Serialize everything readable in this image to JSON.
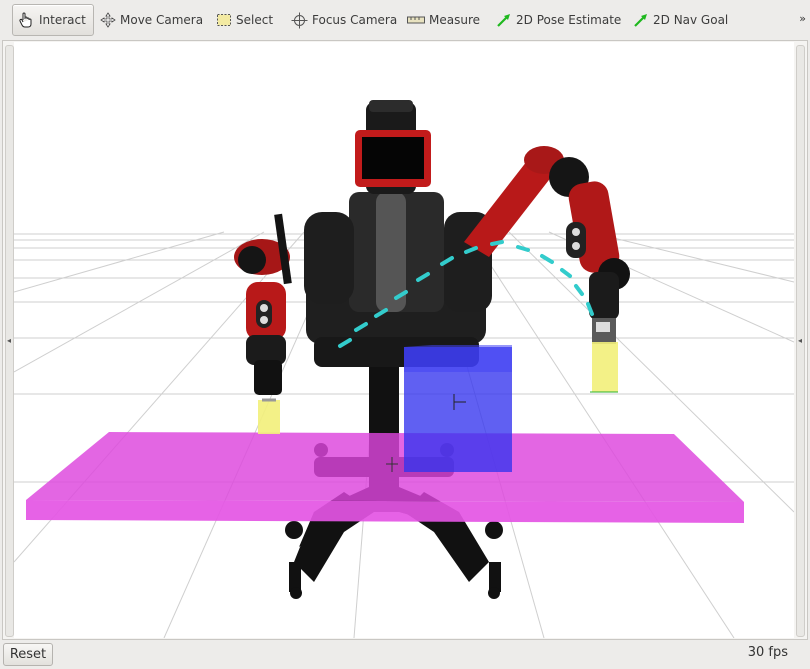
{
  "toolbar": {
    "tools": [
      {
        "label": "Interact",
        "icon": "hand-pointer-icon",
        "active": true
      },
      {
        "label": "Move Camera",
        "icon": "move-arrows-icon"
      },
      {
        "label": "Select",
        "icon": "select-box-icon"
      },
      {
        "label": "Focus Camera",
        "icon": "crosshair-icon"
      },
      {
        "label": "Measure",
        "icon": "ruler-icon"
      },
      {
        "label": "2D Pose Estimate",
        "icon": "green-arrow-icon"
      },
      {
        "label": "2D Nav Goal",
        "icon": "green-arrow-icon"
      }
    ],
    "overflow": "»"
  },
  "status": {
    "reset_label": "Reset",
    "fps": "30 fps"
  },
  "colors": {
    "robot_red": "#b01818",
    "robot_black": "#161616",
    "table_magenta": "#dd44dd",
    "box_blue": "#3333ee",
    "trajectory_cyan": "#33cccc",
    "gripper_yellow": "#f2f07a"
  }
}
